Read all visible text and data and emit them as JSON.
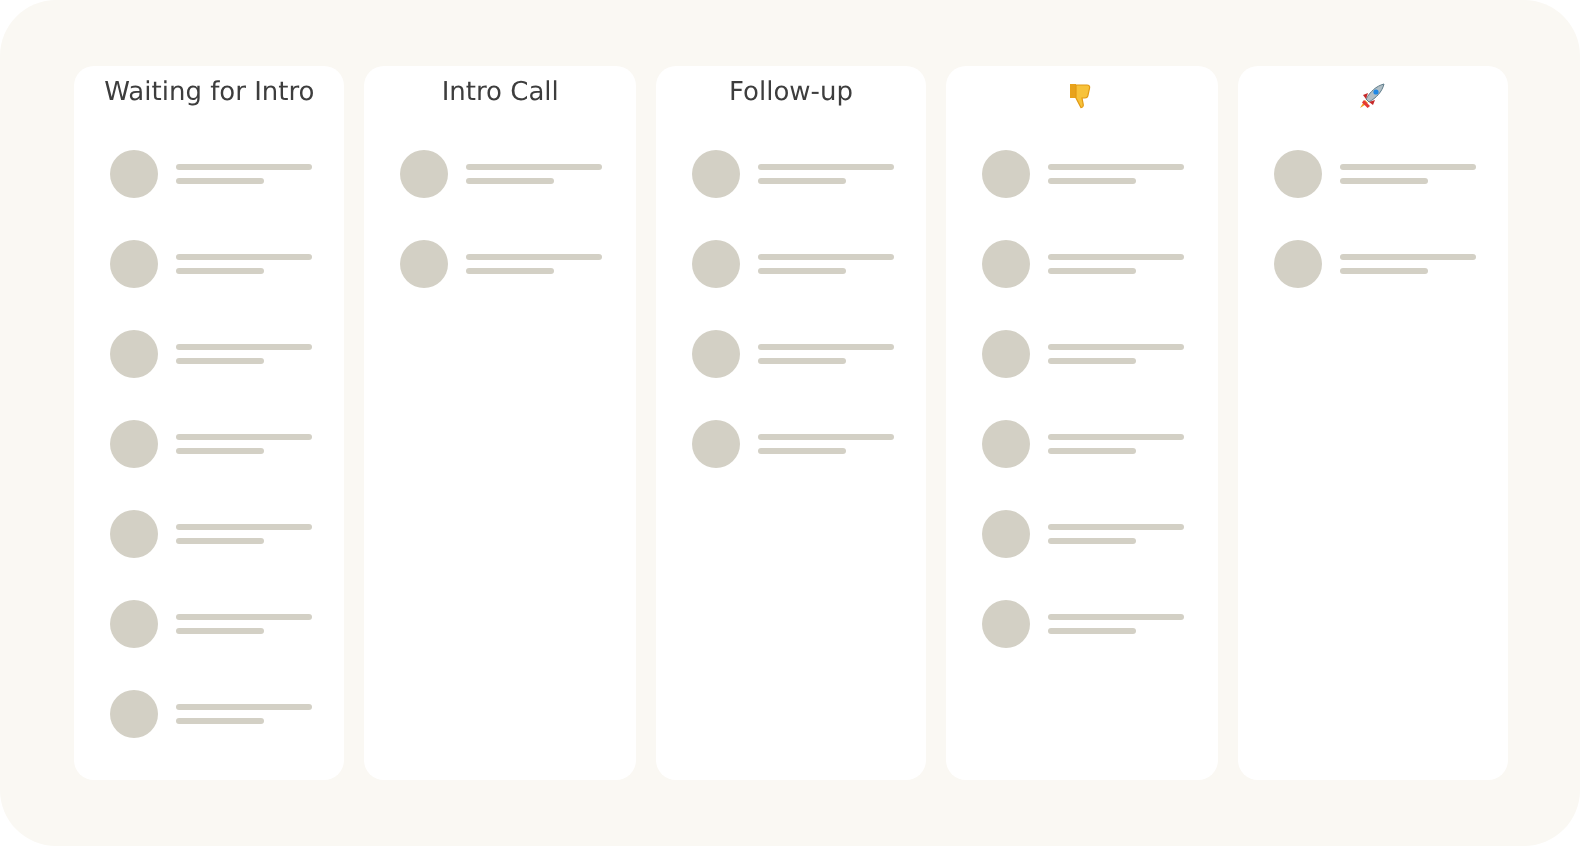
{
  "columns": [
    {
      "title": "Waiting for Intro",
      "cards": [
        {
          "kind": "placeholder"
        },
        {
          "kind": "placeholder"
        },
        {
          "kind": "placeholder"
        },
        {
          "kind": "placeholder"
        },
        {
          "kind": "placeholder"
        },
        {
          "kind": "placeholder"
        },
        {
          "kind": "placeholder"
        }
      ]
    },
    {
      "title": "Intro Call",
      "cards": [
        {
          "kind": "placeholder"
        },
        {
          "kind": "placeholder"
        }
      ]
    },
    {
      "title": "Follow-up",
      "cards": [
        {
          "kind": "placeholder"
        },
        {
          "kind": "placeholder"
        },
        {
          "kind": "placeholder"
        },
        {
          "kind": "placeholder"
        }
      ]
    },
    {
      "kind": "dislike",
      "cards": [
        {
          "kind": "placeholder"
        },
        {
          "kind": "placeholder"
        },
        {
          "kind": "placeholder"
        },
        {
          "kind": "placeholder"
        },
        {
          "kind": "placeholder"
        },
        {
          "kind": "placeholder"
        }
      ]
    },
    {
      "kind": "launch",
      "cards": [
        {
          "kind": "placeholder"
        },
        {
          "kind": "placeholder"
        }
      ]
    }
  ]
}
